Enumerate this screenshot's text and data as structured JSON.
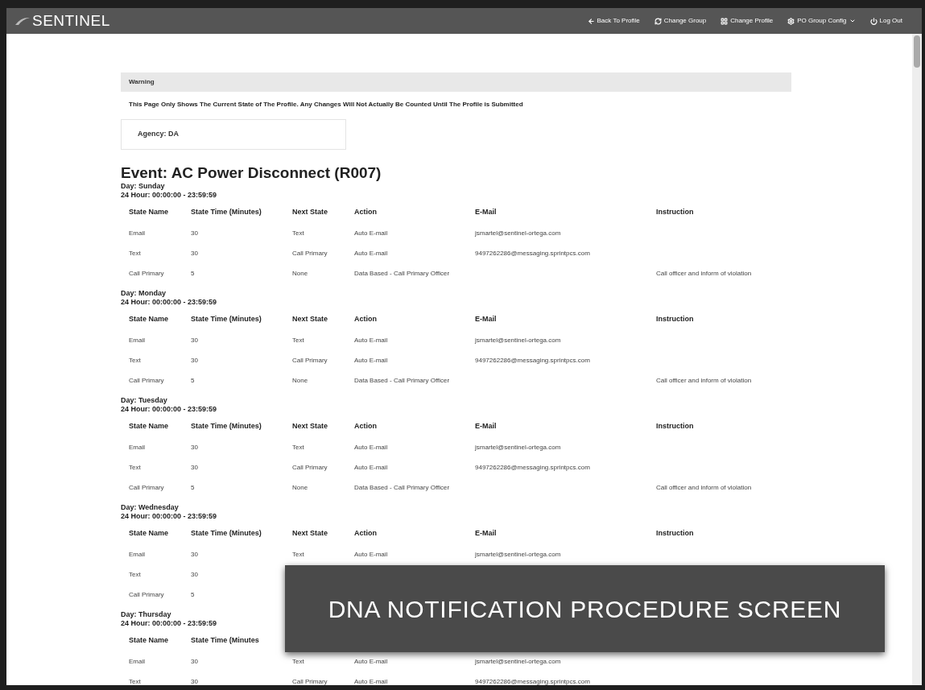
{
  "navbar": {
    "logo": "SENTINEL",
    "links": [
      {
        "label": "Back To Profile",
        "menu": false
      },
      {
        "label": "Change Group",
        "menu": false
      },
      {
        "label": "Change Profile",
        "menu": false
      },
      {
        "label": "PO Group Config",
        "menu": true
      },
      {
        "label": "Log Out",
        "menu": false
      }
    ]
  },
  "warning": {
    "title": "Warning",
    "message": "This Page Only Shows The Current State of The Profile. Any Changes Will Not Actually Be Counted Until The Profile is Submitted"
  },
  "agency": "Agency: DA",
  "event_title": "Event: AC Power Disconnect (R007)",
  "days": [
    {
      "day": "Day: Sunday",
      "hours": "24 Hour: 00:00:00 - 23:59:59",
      "columns": [
        "State Name",
        "State Time (Minutes)",
        "Next State",
        "Action",
        "E-Mail",
        "Instruction"
      ],
      "rows": [
        [
          "Email",
          "30",
          "Text",
          "Auto E-mail",
          "jsmartel@sentinel-ortega.com",
          null
        ],
        [
          "Text",
          "30",
          "Call Primary",
          "Auto E-mail",
          "9497262286@messaging.sprintpcs.com",
          null
        ],
        [
          "Call Primary",
          "5",
          "None",
          "Data Based - Call Primary Officer",
          null,
          "Call officer and inform of violation"
        ]
      ]
    },
    {
      "day": "Day: Monday",
      "hours": "24 Hour: 00:00:00 - 23:59:59",
      "columns": [
        "State Name",
        "State Time (Minutes)",
        "Next State",
        "Action",
        "E-Mail",
        "Instruction"
      ],
      "rows": [
        [
          "Email",
          "30",
          "Text",
          "Auto E-mail",
          "jsmartel@sentinel-ortega.com",
          null
        ],
        [
          "Text",
          "30",
          "Call Primary",
          "Auto E-mail",
          "9497262286@messaging.sprintpcs.com",
          null
        ],
        [
          "Call Primary",
          "5",
          "None",
          "Data Based - Call Primary Officer",
          null,
          "Call officer and inform of violation"
        ]
      ]
    },
    {
      "day": "Day: Tuesday",
      "hours": "24 Hour: 00:00:00 - 23:59:59",
      "columns": [
        "State Name",
        "State Time (Minutes)",
        "Next State",
        "Action",
        "E-Mail",
        "Instruction"
      ],
      "rows": [
        [
          "Email",
          "30",
          "Text",
          "Auto E-mail",
          "jsmartel@sentinel-ortega.com",
          null
        ],
        [
          "Text",
          "30",
          "Call Primary",
          "Auto E-mail",
          "9497262286@messaging.sprintpcs.com",
          null
        ],
        [
          "Call Primary",
          "5",
          "None",
          "Data Based - Call Primary Officer",
          null,
          "Call officer and inform of violation"
        ]
      ]
    },
    {
      "day": "Day: Wednesday",
      "hours": "24 Hour: 00:00:00 - 23:59:59",
      "columns": [
        "State Name",
        "State Time (Minutes)",
        "Next State",
        "Action",
        "E-Mail",
        "Instruction"
      ],
      "rows": [
        [
          "Email",
          "30",
          "Text",
          "Auto E-mail",
          "jsmartel@sentinel-ortega.com",
          null
        ],
        [
          "Text",
          "30",
          null,
          null,
          null,
          null
        ],
        [
          "Call Primary",
          "5",
          null,
          null,
          null,
          null
        ]
      ]
    },
    {
      "day": "Day: Thursday",
      "hours": "24 Hour: 00:00:00 - 23:59:59",
      "columns": [
        "State Name",
        "State Time (Minutes",
        null,
        null,
        null,
        null
      ],
      "rows": [
        [
          "Email",
          "30",
          "Text",
          "Auto E-mail",
          "jsmartel@sentinel-ortega.com",
          null
        ],
        [
          "Text",
          "30",
          "Call Primary",
          "Auto E-mail",
          "9497262286@messaging.sprintpcs.com",
          null
        ]
      ]
    }
  ],
  "caption": "DNA NOTIFICATION PROCEDURE SCREEN"
}
